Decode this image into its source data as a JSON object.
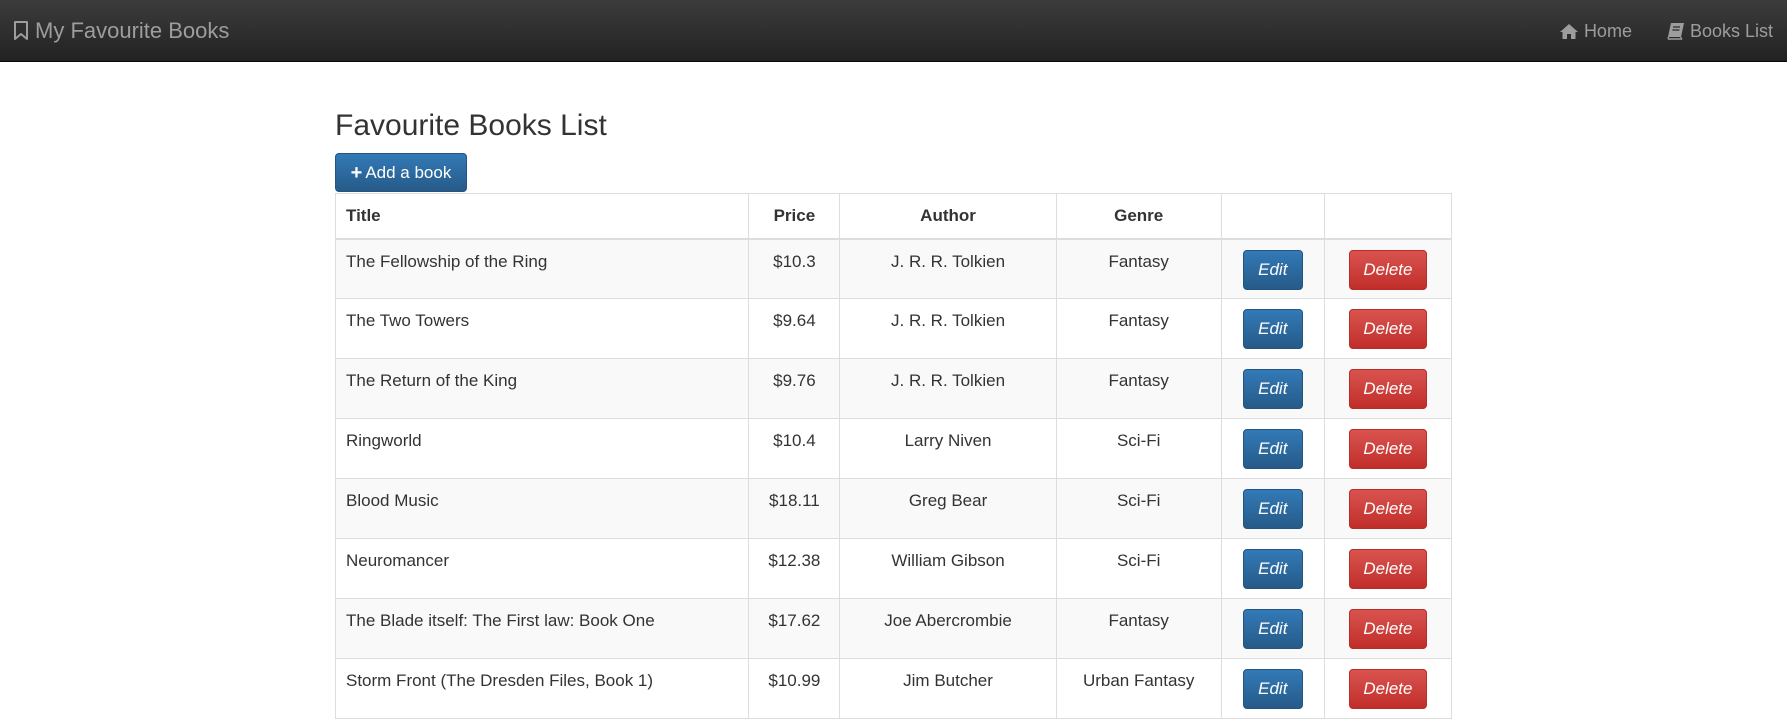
{
  "navbar": {
    "brand": "My Favourite Books",
    "brand_icon": "bookmark-icon",
    "links": [
      {
        "label": "Home",
        "icon": "home-icon"
      },
      {
        "label": "Books List",
        "icon": "book-icon"
      }
    ]
  },
  "page": {
    "title": "Favourite Books List",
    "add_button_label": "Add a book",
    "add_button_icon": "plus-icon"
  },
  "table": {
    "columns": [
      "Title",
      "Price",
      "Author",
      "Genre",
      "",
      ""
    ],
    "rows": [
      {
        "title": "The Fellowship of the Ring",
        "price": "$10.3",
        "author": "J. R. R. Tolkien",
        "genre": "Fantasy",
        "edit": "Edit",
        "delete": "Delete"
      },
      {
        "title": "The Two Towers",
        "price": "$9.64",
        "author": "J. R. R. Tolkien",
        "genre": "Fantasy",
        "edit": "Edit",
        "delete": "Delete"
      },
      {
        "title": "The Return of the King",
        "price": "$9.76",
        "author": "J. R. R. Tolkien",
        "genre": "Fantasy",
        "edit": "Edit",
        "delete": "Delete"
      },
      {
        "title": "Ringworld",
        "price": "$10.4",
        "author": "Larry Niven",
        "genre": "Sci-Fi",
        "edit": "Edit",
        "delete": "Delete"
      },
      {
        "title": "Blood Music",
        "price": "$18.11",
        "author": "Greg Bear",
        "genre": "Sci-Fi",
        "edit": "Edit",
        "delete": "Delete"
      },
      {
        "title": "Neuromancer",
        "price": "$12.38",
        "author": "William Gibson",
        "genre": "Sci-Fi",
        "edit": "Edit",
        "delete": "Delete"
      },
      {
        "title": "The Blade itself: The First law: Book One",
        "price": "$17.62",
        "author": "Joe Abercrombie",
        "genre": "Fantasy",
        "edit": "Edit",
        "delete": "Delete"
      },
      {
        "title": "Storm Front (The Dresden Files, Book 1)",
        "price": "$10.99",
        "author": "Jim Butcher",
        "genre": "Urban Fantasy",
        "edit": "Edit",
        "delete": "Delete"
      }
    ]
  },
  "colors": {
    "navbar_bg": "#222222",
    "primary": "#337ab7",
    "danger": "#d9534f"
  }
}
